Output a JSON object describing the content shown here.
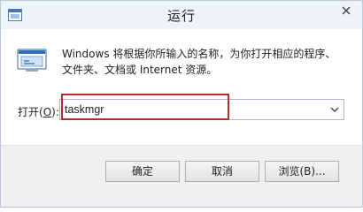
{
  "window": {
    "title": "运行"
  },
  "description": {
    "line1": "Windows 将根据你所输入的名称，为你打开相应的程序、",
    "line2": "文件夹、文档或 Internet 资源。"
  },
  "open_field": {
    "label_prefix": "打开(",
    "label_hotkey": "O",
    "label_suffix": "):",
    "value": "taskmgr"
  },
  "buttons": {
    "ok": "确定",
    "cancel": "取消",
    "browse": "浏览(B)..."
  },
  "icons": {
    "app": "run-app-icon",
    "close": "close-icon",
    "run": "run-program-icon",
    "dropdown": "chevron-down-icon"
  },
  "colors": {
    "highlight": "#b6292e",
    "title_bar": "#eef3f9",
    "footer": "#f0f0f0"
  }
}
